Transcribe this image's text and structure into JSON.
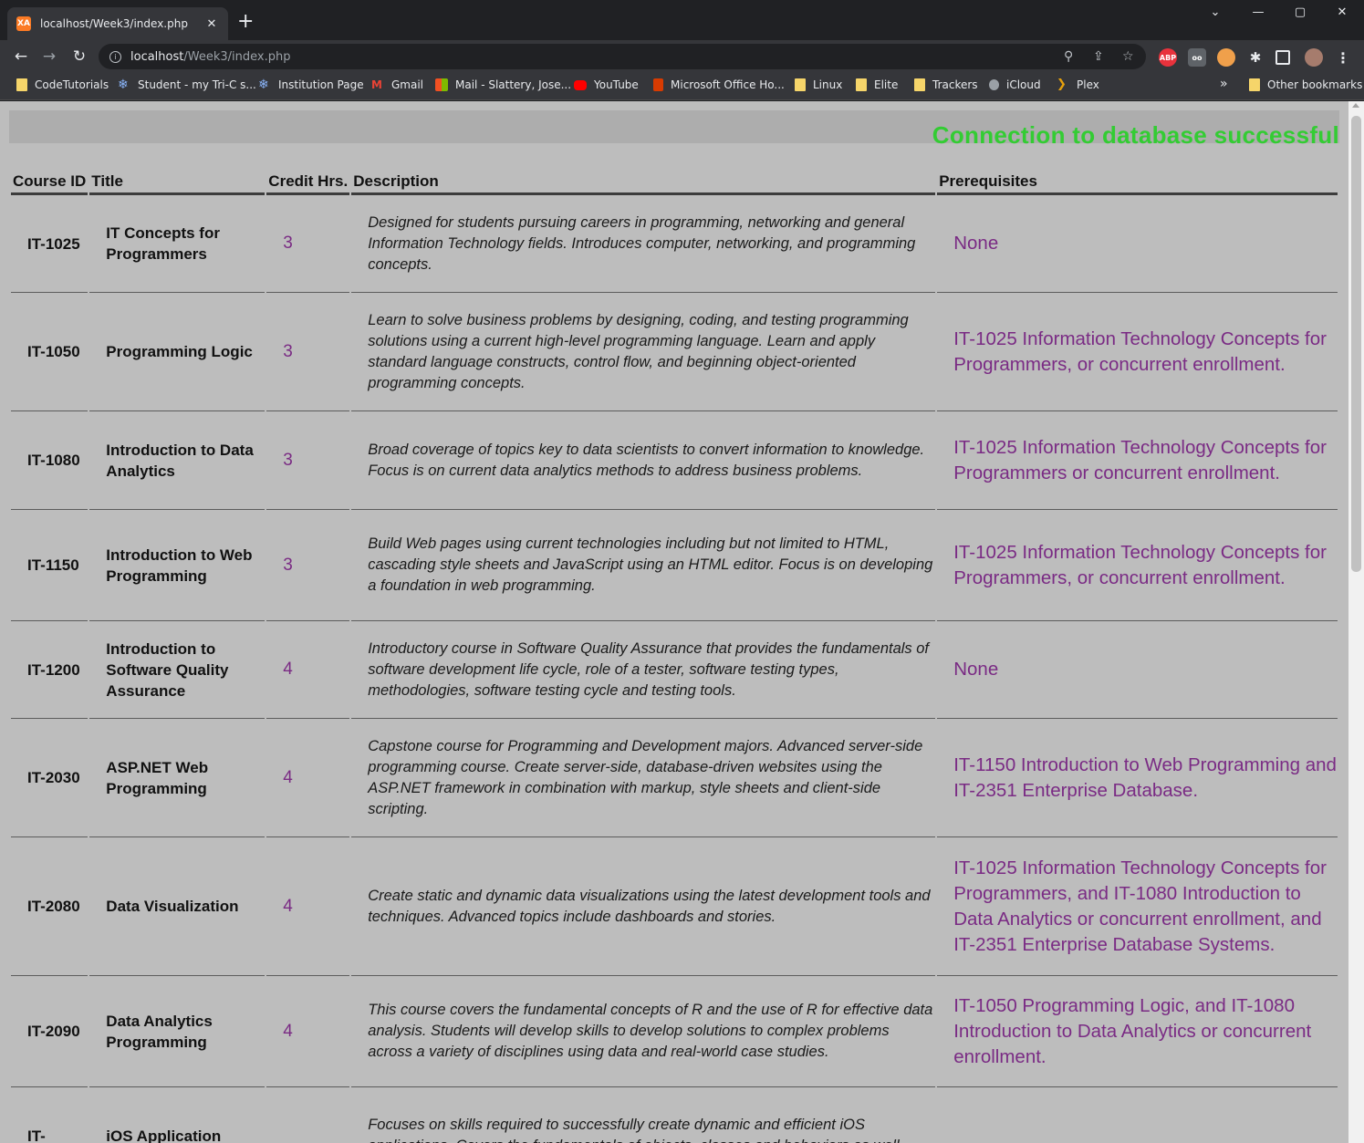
{
  "browser": {
    "tab_title": "localhost/Week3/index.php",
    "favicon_label": "XA",
    "url_host": "localhost",
    "url_path": "/Week3/index.php",
    "bookmarks": [
      {
        "label": "CodeTutorials",
        "icon": "folder-icon"
      },
      {
        "label": "Student - my Tri-C s...",
        "icon": "snowflake-icon"
      },
      {
        "label": "Institution Page",
        "icon": "snowflake-icon"
      },
      {
        "label": "Gmail",
        "icon": "gmail-icon"
      },
      {
        "label": "Mail - Slattery, Jose...",
        "icon": "microsoft-icon"
      },
      {
        "label": "YouTube",
        "icon": "youtube-icon"
      },
      {
        "label": "Microsoft Office Ho...",
        "icon": "office-icon"
      },
      {
        "label": "Linux",
        "icon": "folder-icon"
      },
      {
        "label": "Elite",
        "icon": "folder-icon"
      },
      {
        "label": "Trackers",
        "icon": "folder-icon"
      },
      {
        "label": "iCloud",
        "icon": "apple-icon"
      },
      {
        "label": "Plex",
        "icon": "plex-icon"
      }
    ],
    "overflow": "»",
    "other_bookmarks": "Other bookmarks",
    "abp_label": "ABP"
  },
  "page": {
    "status_message": "Connection to database successful",
    "status_color": "#33cc33",
    "headers": {
      "id": "Course ID",
      "title": "Title",
      "credit": "Credit Hrs.",
      "description": "Description",
      "prereq": "Prerequisites"
    },
    "courses": [
      {
        "id": "IT-1025",
        "title": "IT Concepts for Programmers",
        "credit": "3",
        "description": "Designed for students pursuing careers in programming, networking and general Information Technology fields. Introduces computer, networking, and programming concepts.",
        "prereq": "None"
      },
      {
        "id": "IT-1050",
        "title": "Programming Logic",
        "credit": "3",
        "description": "Learn to solve business problems by designing, coding, and testing programming solutions using a current high-level programming language. Learn and apply standard language constructs, control flow, and beginning object-oriented programming concepts.",
        "prereq": "IT-1025 Information Technology Concepts for Programmers, or concurrent enrollment."
      },
      {
        "id": "IT-1080",
        "title": "Introduction to Data Analytics",
        "credit": "3",
        "description": "Broad coverage of topics key to data scientists to convert information to knowledge. Focus is on current data analytics methods to address business problems.",
        "prereq": "IT-1025 Information Technology Concepts for Programmers or concurrent enrollment."
      },
      {
        "id": "IT-1150",
        "title": "Introduction to Web Programming",
        "credit": "3",
        "description": "Build Web pages using current technologies including but not limited to HTML, cascading style sheets and JavaScript using an HTML editor. Focus is on developing a foundation in web programming.",
        "prereq": "IT-1025 Information Technology Concepts for Programmers, or concurrent enrollment."
      },
      {
        "id": "IT-1200",
        "title": "Introduction to Software Quality Assurance",
        "credit": "4",
        "description": "Introductory course in Software Quality Assurance that provides the fundamentals of software development life cycle, role of a tester, software testing types, methodologies, software testing cycle and testing tools.",
        "prereq": "None"
      },
      {
        "id": "IT-2030",
        "title": "ASP.NET Web Programming",
        "credit": "4",
        "description": "Capstone course for Programming and Development majors. Advanced server-side programming course. Create server-side, database-driven websites using the ASP.NET framework in combination with markup, style sheets and client-side scripting.",
        "prereq": "IT-1150 Introduction to Web Programming and IT-2351 Enterprise Database."
      },
      {
        "id": "IT-2080",
        "title": "Data Visualization",
        "credit": "4",
        "description": "Create static and dynamic data visualizations using the latest development tools and techniques. Advanced topics include dashboards and stories.",
        "prereq": "IT-1025 Information Technology Concepts for Programmers, and IT-1080 Introduction to Data Analytics or concurrent enrollment, and IT-2351 Enterprise Database Systems."
      },
      {
        "id": "IT-2090",
        "title": "Data Analytics Programming",
        "credit": "4",
        "description": "This course covers the fundamental concepts of R and the use of R for effective data analysis. Students will develop skills to develop solutions to complex problems across a variety of disciplines using data and real-world case studies.",
        "prereq": "IT-1050 Programming Logic, and IT-1080 Introduction to Data Analytics or concurrent enrollment."
      },
      {
        "id": "IT-",
        "title": "iOS Application",
        "credit": "",
        "description": "Focuses on skills required to successfully create dynamic and efficient iOS applications. Covers the fundamentals of objects, classes and behaviors as well",
        "prereq": ""
      }
    ]
  }
}
